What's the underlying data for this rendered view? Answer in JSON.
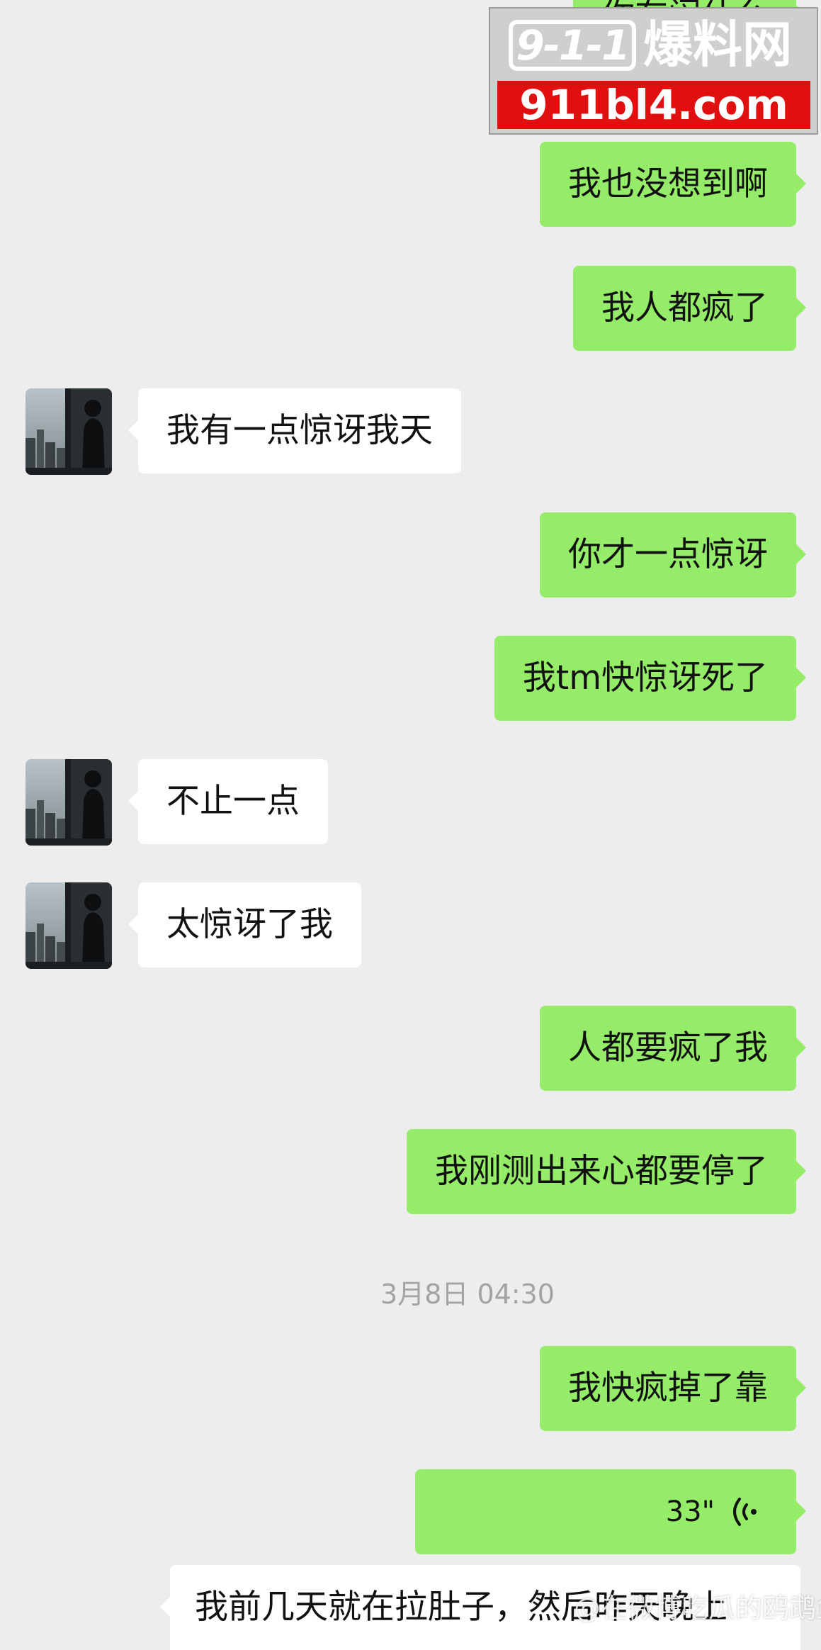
{
  "messages": [
    {
      "side": "me",
      "text": "你在闹什么"
    },
    {
      "side": "me",
      "text": "我也没想到啊"
    },
    {
      "side": "me",
      "text": "我人都疯了"
    },
    {
      "side": "them",
      "text": "我有一点惊讶我天"
    },
    {
      "side": "me",
      "text": "你才一点惊讶"
    },
    {
      "side": "me",
      "text": "我tm快惊讶死了"
    },
    {
      "side": "them",
      "text": "不止一点"
    },
    {
      "side": "them",
      "text": "太惊讶了我"
    },
    {
      "side": "me",
      "text": "人都要疯了我"
    },
    {
      "side": "me",
      "text": "我刚测出来心都要停了"
    },
    {
      "side": "me",
      "text": "我快疯掉了靠"
    },
    {
      "side": "them",
      "text": "我前几天就在拉肚子，然后昨天晚上"
    }
  ],
  "timestamp": "3月8日 04:30",
  "voice_message": {
    "duration": "33\"",
    "icon": "voice-wave-icon"
  },
  "watermark": {
    "logo_number": "9-1-1",
    "logo_name": "爆料网",
    "url": "911bl4.com"
  },
  "weibo_watermark": "@在微博吃瓜的鸥鹉鱼",
  "colors": {
    "background": "#ededed",
    "my_bubble": "#95ec69",
    "their_bubble": "#ffffff",
    "timestamp_text": "#a3a3a3"
  }
}
